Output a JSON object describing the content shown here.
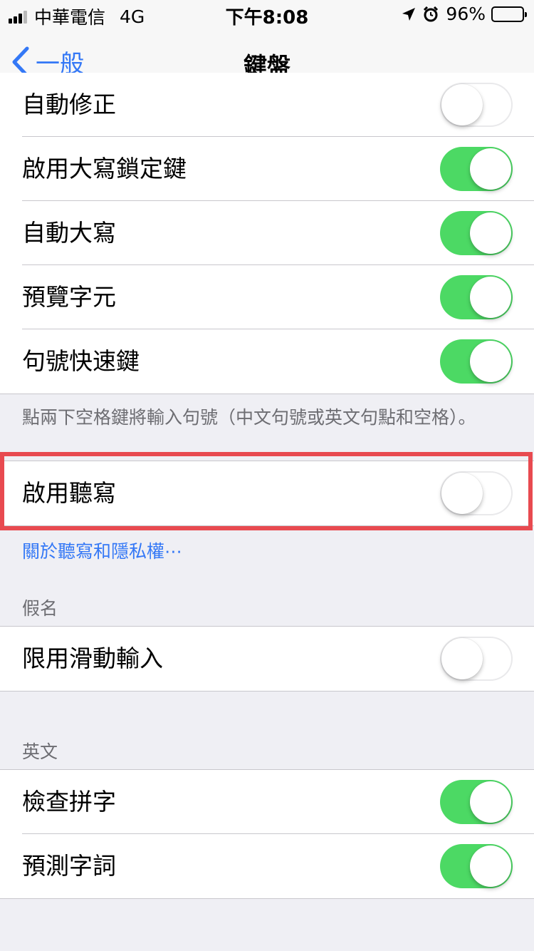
{
  "status_bar": {
    "carrier": "中華電信",
    "network": "4G",
    "time": "下午8:08",
    "battery": "96%",
    "battery_level": 0.96,
    "icons": [
      "location-arrow-icon",
      "alarm-icon"
    ]
  },
  "nav": {
    "back_label": "一般",
    "title": "鍵盤"
  },
  "group1": [
    {
      "label": "自動修正",
      "on": false
    },
    {
      "label": "啟用大寫鎖定鍵",
      "on": true
    },
    {
      "label": "自動大寫",
      "on": true
    },
    {
      "label": "預覽字元",
      "on": true
    },
    {
      "label": "句號快速鍵",
      "on": true
    }
  ],
  "group1_footer": "點兩下空格鍵將輸入句號（中文句號或英文句點和空格）。",
  "dictation": {
    "label": "啟用聽寫",
    "on": false
  },
  "dictation_link": "關於聽寫和隱私權⋯",
  "kana_section": {
    "header": "假名",
    "rows": [
      {
        "label": "限用滑動輸入",
        "on": false
      }
    ]
  },
  "english_section": {
    "header": "英文",
    "rows": [
      {
        "label": "檢查拼字",
        "on": true
      },
      {
        "label": "預測字詞",
        "on": true
      }
    ]
  },
  "colors": {
    "accent": "#3478f6",
    "toggle_on": "#4cd964",
    "highlight": "#e84a50",
    "background": "#efeff4"
  }
}
